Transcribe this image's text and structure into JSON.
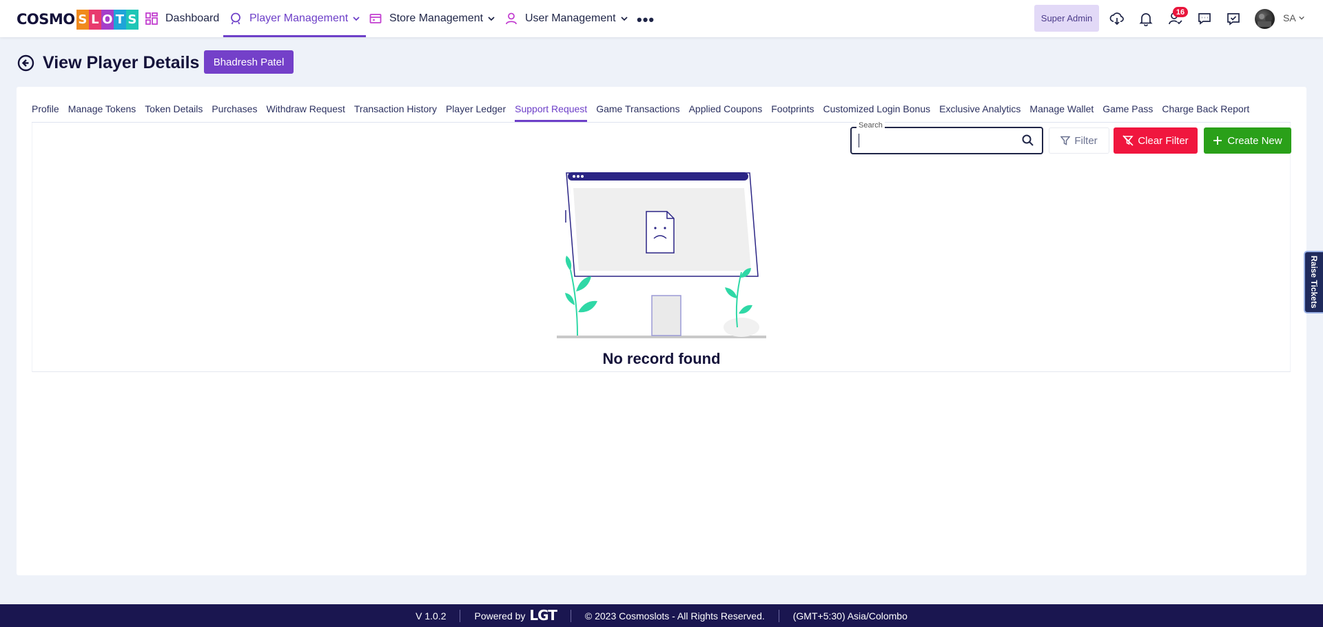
{
  "brand": {
    "logo_text_1": "COSMO",
    "logo_text_2_letters": [
      "S",
      "L",
      "O",
      "T",
      "S"
    ],
    "logo_colors": [
      "#f08a1d",
      "#e83a6e",
      "#a53ec9",
      "#1ea4d8",
      "#1ec6b6"
    ]
  },
  "nav": {
    "items": [
      {
        "label": "Dashboard",
        "icon": "dashboard-grid-icon"
      },
      {
        "label": "Player Management",
        "icon": "player-icon",
        "active": true
      },
      {
        "label": "Store Management",
        "icon": "store-icon"
      },
      {
        "label": "User Management",
        "icon": "user-icon"
      }
    ],
    "more": "•••",
    "role": "Super Admin",
    "notification_count": "16",
    "user_initials": "SA"
  },
  "page": {
    "title": "View Player Details",
    "player_name": "Bhadresh Patel"
  },
  "tabs": [
    {
      "label": "Profile"
    },
    {
      "label": "Manage Tokens"
    },
    {
      "label": "Token Details"
    },
    {
      "label": "Purchases"
    },
    {
      "label": "Withdraw Request"
    },
    {
      "label": "Transaction History"
    },
    {
      "label": "Player Ledger"
    },
    {
      "label": "Support Request",
      "active": true
    },
    {
      "label": "Game Transactions"
    },
    {
      "label": "Applied Coupons"
    },
    {
      "label": "Footprints"
    },
    {
      "label": "Customized Login Bonus"
    },
    {
      "label": "Exclusive Analytics"
    },
    {
      "label": "Manage Wallet"
    },
    {
      "label": "Game Pass"
    },
    {
      "label": "Charge Back Report"
    }
  ],
  "toolbar": {
    "search_label": "Search",
    "search_value": "",
    "filter_label": "Filter",
    "clear_filter_label": "Clear Filter",
    "create_new_label": "Create New"
  },
  "empty_state": {
    "message": "No record found"
  },
  "side_tab": {
    "label": "Raise Tickets"
  },
  "footer": {
    "version": "V 1.0.2",
    "powered_by": "Powered by",
    "powered_brand": "LGT",
    "copyright": "© 2023 Cosmoslots - All Rights Reserved.",
    "timezone": "(GMT+5:30) Asia/Colombo"
  },
  "colors": {
    "primary": "#6d3fc8",
    "danger": "#f0163e",
    "success": "#2aa019",
    "footer_bg": "#1a1650",
    "accent_green": "#2fd8a6"
  }
}
